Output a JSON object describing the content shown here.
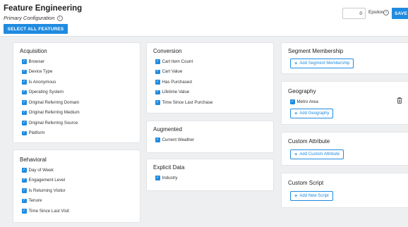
{
  "header": {
    "title": "Feature Engineering",
    "subtitle": "Primary Configuration",
    "select_all_label": "SELECT ALL FEATURES",
    "epsilon_value": "0",
    "epsilon_label": "Epsilon",
    "save_label": "SAVE"
  },
  "panels": {
    "acquisition": {
      "title": "Acquisition",
      "items": [
        "Browser",
        "Device Type",
        "Is Anonymous",
        "Operating System",
        "Original Referring Domain",
        "Original Referring Medium",
        "Original Referring Source",
        "Platform"
      ]
    },
    "behavioral": {
      "title": "Behavioral",
      "items": [
        "Day of Week",
        "Engagement Level",
        "Is Returning Visitor",
        "Tenure",
        "Time Since Last Visit"
      ]
    },
    "conversion": {
      "title": "Conversion",
      "items": [
        "Cart Item Count",
        "Cart Value",
        "Has Purchased",
        "Lifetime Value",
        "Time Since Last Purchase"
      ]
    },
    "augmented": {
      "title": "Augmented",
      "items": [
        "Current Weather"
      ]
    },
    "explicit_data": {
      "title": "Explicit Data",
      "items": [
        "Industry"
      ]
    },
    "segment_membership": {
      "title": "Segment Membership",
      "button_label": "Add Segment Membership"
    },
    "geography": {
      "title": "Geography",
      "items": [
        "Metro Area"
      ],
      "button_label": "Add Geography"
    },
    "custom_attribute": {
      "title": "Custom Attribute",
      "button_label": "Add Custom Attribute"
    },
    "custom_script": {
      "title": "Custom Script",
      "button_label": "Add New Script"
    }
  },
  "icons": {
    "checkbox": "checkbox-checked-icon",
    "info": "info-icon",
    "trash": "trash-icon",
    "plus": "plus-icon"
  },
  "colors": {
    "accent": "#1f8be0",
    "background": "#eeeff1",
    "panel": "#ffffff"
  }
}
